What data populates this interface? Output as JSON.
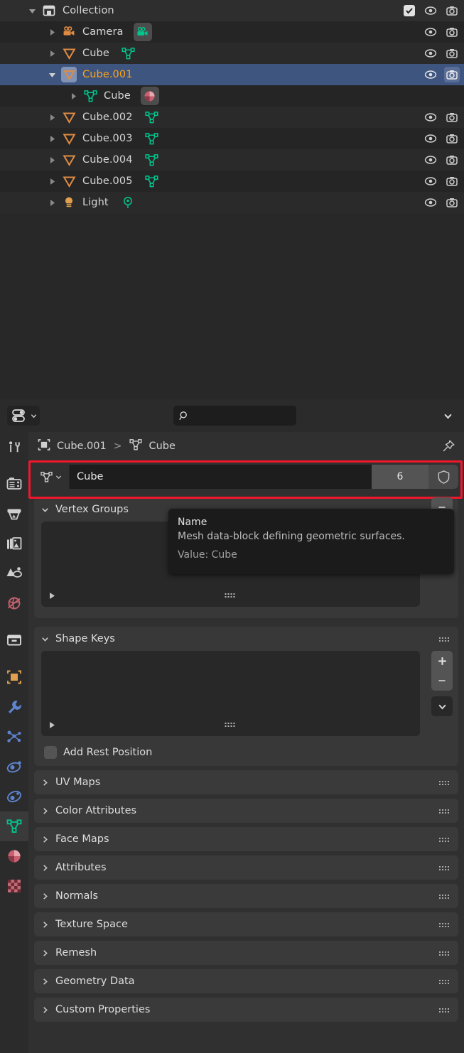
{
  "outliner": {
    "rows": [
      {
        "label": "Collection",
        "icon": "collection-icon",
        "indent": 0,
        "expanded": true,
        "arrow": "down",
        "selected": false,
        "active": false,
        "datachip": null,
        "right": [
          "checkbox",
          "eye",
          "camera"
        ]
      },
      {
        "label": "Camera",
        "icon": "camera-object-icon",
        "indent": 1,
        "expanded": false,
        "arrow": "right",
        "selected": false,
        "active": false,
        "datachip": "camera-data-icon",
        "chipbg": true,
        "right": [
          "eye",
          "camera"
        ]
      },
      {
        "label": "Cube",
        "icon": "mesh-object-icon",
        "indent": 1,
        "expanded": false,
        "arrow": "right",
        "selected": false,
        "active": false,
        "datachip": "mesh-data-icon",
        "chipbg": false,
        "right": [
          "eye",
          "camera"
        ]
      },
      {
        "label": "Cube.001",
        "icon": "mesh-object-icon",
        "indent": 1,
        "expanded": true,
        "arrow": "down",
        "selected": true,
        "active": true,
        "datachip": null,
        "right": [
          "eye",
          "camera"
        ]
      },
      {
        "label": "Cube",
        "icon": "mesh-data-icon",
        "indent": 2,
        "expanded": false,
        "arrow": "right",
        "selected": false,
        "active": false,
        "datachip": "material-icon",
        "chipbg": true,
        "right": []
      },
      {
        "label": "Cube.002",
        "icon": "mesh-object-icon",
        "indent": 1,
        "expanded": false,
        "arrow": "right",
        "selected": false,
        "active": false,
        "datachip": "mesh-data-icon",
        "chipbg": false,
        "right": [
          "eye",
          "camera"
        ]
      },
      {
        "label": "Cube.003",
        "icon": "mesh-object-icon",
        "indent": 1,
        "expanded": false,
        "arrow": "right",
        "selected": false,
        "active": false,
        "datachip": "mesh-data-icon",
        "chipbg": false,
        "right": [
          "eye",
          "camera"
        ]
      },
      {
        "label": "Cube.004",
        "icon": "mesh-object-icon",
        "indent": 1,
        "expanded": false,
        "arrow": "right",
        "selected": false,
        "active": false,
        "datachip": "mesh-data-icon",
        "chipbg": false,
        "right": [
          "eye",
          "camera"
        ]
      },
      {
        "label": "Cube.005",
        "icon": "mesh-object-icon",
        "indent": 1,
        "expanded": false,
        "arrow": "right",
        "selected": false,
        "active": false,
        "datachip": "mesh-data-icon",
        "chipbg": false,
        "right": [
          "eye",
          "camera"
        ]
      },
      {
        "label": "Light",
        "icon": "light-object-icon",
        "indent": 1,
        "expanded": false,
        "arrow": "right",
        "selected": false,
        "active": false,
        "datachip": "light-data-icon",
        "chipbg": false,
        "right": [
          "eye",
          "camera"
        ]
      }
    ],
    "row_labels": {
      "r0": "Collection",
      "r1": "Camera",
      "r2": "Cube",
      "r3": "Cube.001",
      "r4": "Cube",
      "r5": "Cube.002",
      "r6": "Cube.003",
      "r7": "Cube.004",
      "r8": "Cube.005",
      "r9": "Light"
    }
  },
  "properties_header": {
    "editor_type_icon": "properties-editor-icon",
    "search_value": "",
    "search_placeholder": "",
    "options_chevron_icon": "chevron-down-icon"
  },
  "tabs": [
    {
      "name": "tab-tool",
      "icon": "tool-icon",
      "active": false
    },
    {
      "name": "tab-render",
      "icon": "render-camera-icon",
      "active": false
    },
    {
      "name": "tab-output",
      "icon": "printer-icon",
      "active": false
    },
    {
      "name": "tab-view-layer",
      "icon": "images-icon",
      "active": false
    },
    {
      "name": "tab-scene",
      "icon": "scene-cone-icon",
      "active": false
    },
    {
      "name": "tab-world",
      "icon": "world-globe-icon",
      "active": false
    },
    {
      "name": "tab-collection",
      "icon": "collection-box-icon",
      "active": false
    },
    {
      "name": "tab-object",
      "icon": "object-square-icon",
      "active": false
    },
    {
      "name": "tab-modifiers",
      "icon": "wrench-icon",
      "active": false
    },
    {
      "name": "tab-particles",
      "icon": "particles-icon",
      "active": false
    },
    {
      "name": "tab-physics",
      "icon": "physics-orbit-icon",
      "active": false
    },
    {
      "name": "tab-constraints",
      "icon": "constraints-icon",
      "active": false
    },
    {
      "name": "tab-object-data",
      "icon": "mesh-data-icon",
      "active": true
    },
    {
      "name": "tab-material",
      "icon": "material-sphere-icon",
      "active": false
    },
    {
      "name": "tab-texture",
      "icon": "texture-checker-icon",
      "active": false
    }
  ],
  "breadcrumb": {
    "object_icon": "object-square-icon",
    "object": "Cube.001",
    "separator": ">",
    "data_icon": "mesh-data-icon",
    "data": "Cube",
    "pin_icon": "pin-icon"
  },
  "datablock": {
    "id_icon": "mesh-data-icon",
    "id_chevron": "chevron-down-icon",
    "name": "Cube",
    "users": "6",
    "fake_user_icon": "shield-icon",
    "highlight_color": "#f1172b"
  },
  "tooltip": {
    "title": "Name",
    "description": "Mesh data-block defining geometric surfaces.",
    "value": "Value: Cube"
  },
  "panels": {
    "vertex_groups": {
      "title": "Vertex Groups",
      "chevron": "chevron-down-icon",
      "buttons": {
        "remove": "minus-icon",
        "specials": "chevron-down-icon"
      },
      "list_expand_icon": "play-triangle-icon",
      "grip_icon": "grip-dots-icon"
    },
    "shape_keys": {
      "title": "Shape Keys",
      "chevron": "chevron-down-icon",
      "buttons": {
        "add": "plus-icon",
        "remove": "minus-icon",
        "specials": "chevron-down-icon"
      },
      "list_expand_icon": "play-triangle-icon",
      "grip_icon": "grip-dots-icon",
      "add_rest_position": {
        "label": "Add Rest Position",
        "checked": false
      }
    },
    "closed": [
      {
        "title": "UV Maps",
        "chevron": "chevron-right-icon",
        "grip": "grip-dots-icon"
      },
      {
        "title": "Color Attributes",
        "chevron": "chevron-right-icon",
        "grip": "grip-dots-icon"
      },
      {
        "title": "Face Maps",
        "chevron": "chevron-right-icon",
        "grip": "grip-dots-icon"
      },
      {
        "title": "Attributes",
        "chevron": "chevron-right-icon",
        "grip": "grip-dots-icon"
      },
      {
        "title": "Normals",
        "chevron": "chevron-right-icon",
        "grip": "grip-dots-icon"
      },
      {
        "title": "Texture Space",
        "chevron": "chevron-right-icon",
        "grip": "grip-dots-icon"
      },
      {
        "title": "Remesh",
        "chevron": "chevron-right-icon",
        "grip": "grip-dots-icon"
      },
      {
        "title": "Geometry Data",
        "chevron": "chevron-right-icon",
        "grip": "grip-dots-icon"
      },
      {
        "title": "Custom Properties",
        "chevron": "chevron-right-icon",
        "grip": "grip-dots-icon"
      }
    ]
  },
  "colors": {
    "selection_blue": "#3e557f",
    "active_orange": "#ffa219",
    "mesh_green": "#00c68e",
    "object_orange": "#e08b42",
    "highlight_red": "#f1172b"
  }
}
